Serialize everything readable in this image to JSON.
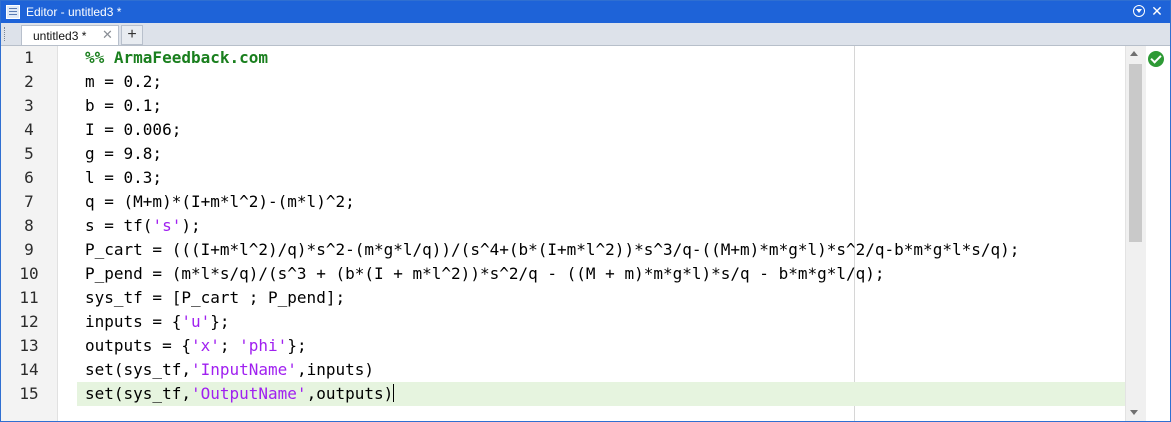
{
  "window": {
    "title": "Editor - untitled3 *",
    "title_bar_color": "#1e63d8",
    "close_icon": "close-icon",
    "menu_icon": "chevron-down-circle-icon"
  },
  "tabs": {
    "active_label": "untitled3 *",
    "close_glyph": "✕",
    "new_tab_glyph": "+"
  },
  "editor": {
    "line_numbers": [
      "1",
      "2",
      "3",
      "4",
      "5",
      "6",
      "7",
      "8",
      "9",
      "10",
      "11",
      "12",
      "13",
      "14",
      "15"
    ],
    "current_line": 15,
    "status_icon": "check-circle-icon",
    "colors": {
      "section": "#1a7f1e",
      "string": "#a020f0",
      "current_line_highlight": "#e6f4df"
    },
    "lines": [
      [
        {
          "text": "%% ArmaFeedback.com",
          "type": "section"
        }
      ],
      [
        {
          "text": "m = 0.2;",
          "type": "code"
        }
      ],
      [
        {
          "text": "b = 0.1;",
          "type": "code"
        }
      ],
      [
        {
          "text": "I = 0.006;",
          "type": "code"
        }
      ],
      [
        {
          "text": "g = 9.8;",
          "type": "code"
        }
      ],
      [
        {
          "text": "l = 0.3;",
          "type": "code"
        }
      ],
      [
        {
          "text": "q = (M+m)*(I+m*l^2)-(m*l)^2;",
          "type": "code"
        }
      ],
      [
        {
          "text": "s = tf(",
          "type": "code"
        },
        {
          "text": "'s'",
          "type": "string"
        },
        {
          "text": ");",
          "type": "code"
        }
      ],
      [
        {
          "text": "P_cart = (((I+m*l^2)/q)*s^2-(m*g*l/q))/(s^4+(b*(I+m*l^2))*s^3/q-((M+m)*m*g*l)*s^2/q-b*m*g*l*s/q);",
          "type": "code"
        }
      ],
      [
        {
          "text": "P_pend = (m*l*s/q)/(s^3 + (b*(I + m*l^2))*s^2/q - ((M + m)*m*g*l)*s/q - b*m*g*l/q);",
          "type": "code"
        }
      ],
      [
        {
          "text": "sys_tf = [P_cart ; P_pend];",
          "type": "code"
        }
      ],
      [
        {
          "text": "inputs = {",
          "type": "code"
        },
        {
          "text": "'u'",
          "type": "string"
        },
        {
          "text": "};",
          "type": "code"
        }
      ],
      [
        {
          "text": "outputs = {",
          "type": "code"
        },
        {
          "text": "'x'",
          "type": "string"
        },
        {
          "text": "; ",
          "type": "code"
        },
        {
          "text": "'phi'",
          "type": "string"
        },
        {
          "text": "};",
          "type": "code"
        }
      ],
      [
        {
          "text": "set(sys_tf,",
          "type": "code"
        },
        {
          "text": "'InputName'",
          "type": "string"
        },
        {
          "text": ",inputs)",
          "type": "code"
        }
      ],
      [
        {
          "text": "set(sys_tf,",
          "type": "code"
        },
        {
          "text": "'OutputName'",
          "type": "string"
        },
        {
          "text": ",outputs)",
          "type": "code"
        }
      ]
    ]
  }
}
